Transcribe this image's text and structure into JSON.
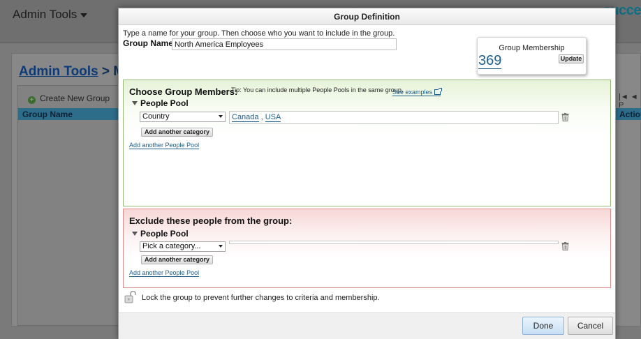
{
  "background": {
    "admin_menu_label": "Admin Tools",
    "logo_text": "succe",
    "heading_link": "Admin Tools",
    "heading_rest": " > Ma",
    "create_group_label": "Create New Group",
    "table_header_left": "Group Name",
    "table_header_right": "Action",
    "pager_text": "|◄ ◄ P"
  },
  "dialog": {
    "title": "Group Definition",
    "close_glyph": "×",
    "instructions": "Type a name for your group. Then choose who you want to include in the group.",
    "group_name_label": "Group Name",
    "group_name_value": "North America Employees",
    "membership": {
      "title": "Group Membership",
      "count": "369",
      "update_label": "Update"
    },
    "include": {
      "title": "Choose Group Members:",
      "tip": "Tip: You can include multiple People Pools in the same group.",
      "see_examples": "See examples",
      "pool_label": "People Pool",
      "category_selected": "Country",
      "values": [
        "Canada",
        "USA"
      ],
      "values_separator": " , ",
      "add_category_label": "Add another category",
      "add_pool_label": "Add another People Pool"
    },
    "splitter_glyph": ". . .",
    "exclude": {
      "title": "Exclude these people from the group:",
      "pool_label": "People Pool",
      "category_placeholder": "Pick a category...",
      "add_category_label": "Add another category",
      "add_pool_label": "Add another People Pool"
    },
    "lock_text": "Lock the group to prevent further changes to criteria and membership.",
    "done_label": "Done",
    "cancel_label": "Cancel"
  },
  "colors": {
    "include_border": "#99b877",
    "exclude_border": "#e08b89",
    "link": "#1b5e8c",
    "primary_button": "#c8dff4"
  },
  "icons": [
    "chevron-down-icon",
    "plus-circle-icon",
    "close-icon",
    "external-link-icon",
    "collapse-triangle-icon",
    "trash-icon",
    "unlocked-padlock-icon"
  ]
}
